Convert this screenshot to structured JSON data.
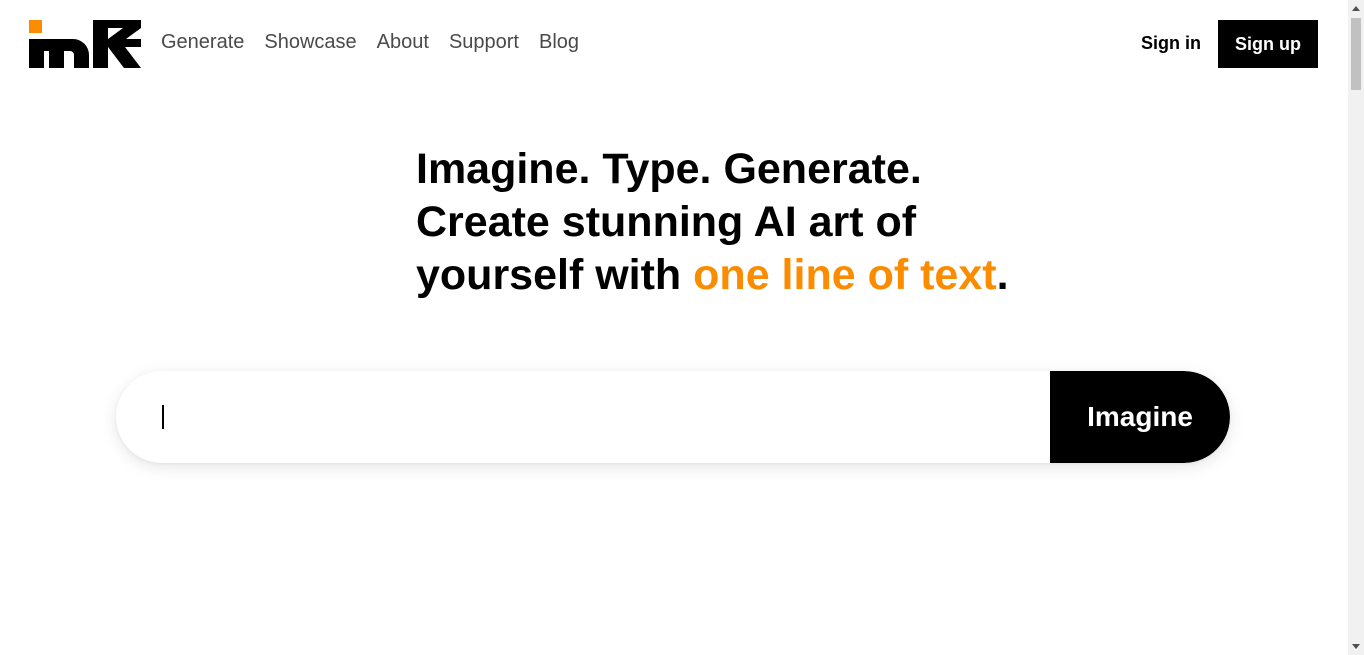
{
  "brand": {
    "logo_icon": "mk-logo",
    "accent_color": "#fb8c00"
  },
  "nav": {
    "items": [
      {
        "label": "Generate"
      },
      {
        "label": "Showcase"
      },
      {
        "label": "About"
      },
      {
        "label": "Support"
      },
      {
        "label": "Blog"
      }
    ]
  },
  "auth": {
    "signin_label": "Sign in",
    "signup_label": "Sign up"
  },
  "hero": {
    "line1": "Imagine. Type. Generate.",
    "line2": "Create stunning AI art of",
    "line3_prefix": "yourself with ",
    "line3_accent": "one line of text",
    "line3_suffix": "."
  },
  "prompt": {
    "value": "",
    "placeholder": "",
    "button_label": "Imagine"
  }
}
